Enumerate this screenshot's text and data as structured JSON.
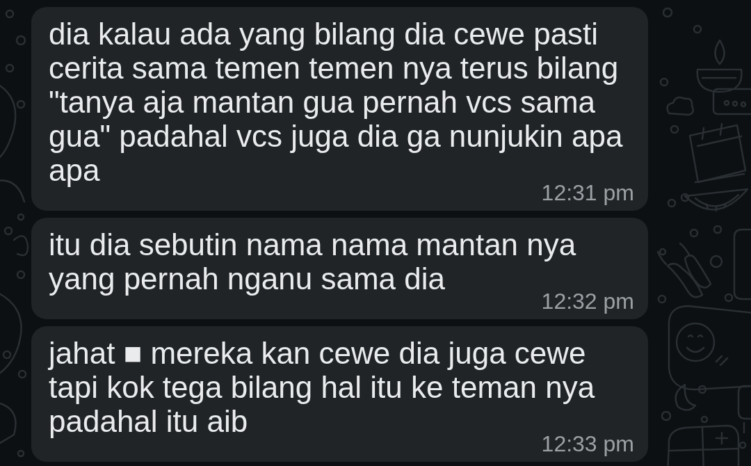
{
  "chat": {
    "messages": [
      {
        "text": "dia kalau ada yang bilang dia cewe pasti cerita sama temen temen nya terus bilang \"tanya aja mantan gua pernah vcs sama gua\" padahal vcs juga dia ga nunjukin apa apa",
        "time": "12:31 pm"
      },
      {
        "text": "itu dia sebutin nama nama mantan nya yang pernah nganu sama dia",
        "time": "12:32 pm"
      },
      {
        "text": "jahat ■ mereka kan cewe dia juga cewe tapi kok tega bilang hal itu ke teman nya padahal itu aib",
        "time": "12:33 pm"
      }
    ]
  }
}
